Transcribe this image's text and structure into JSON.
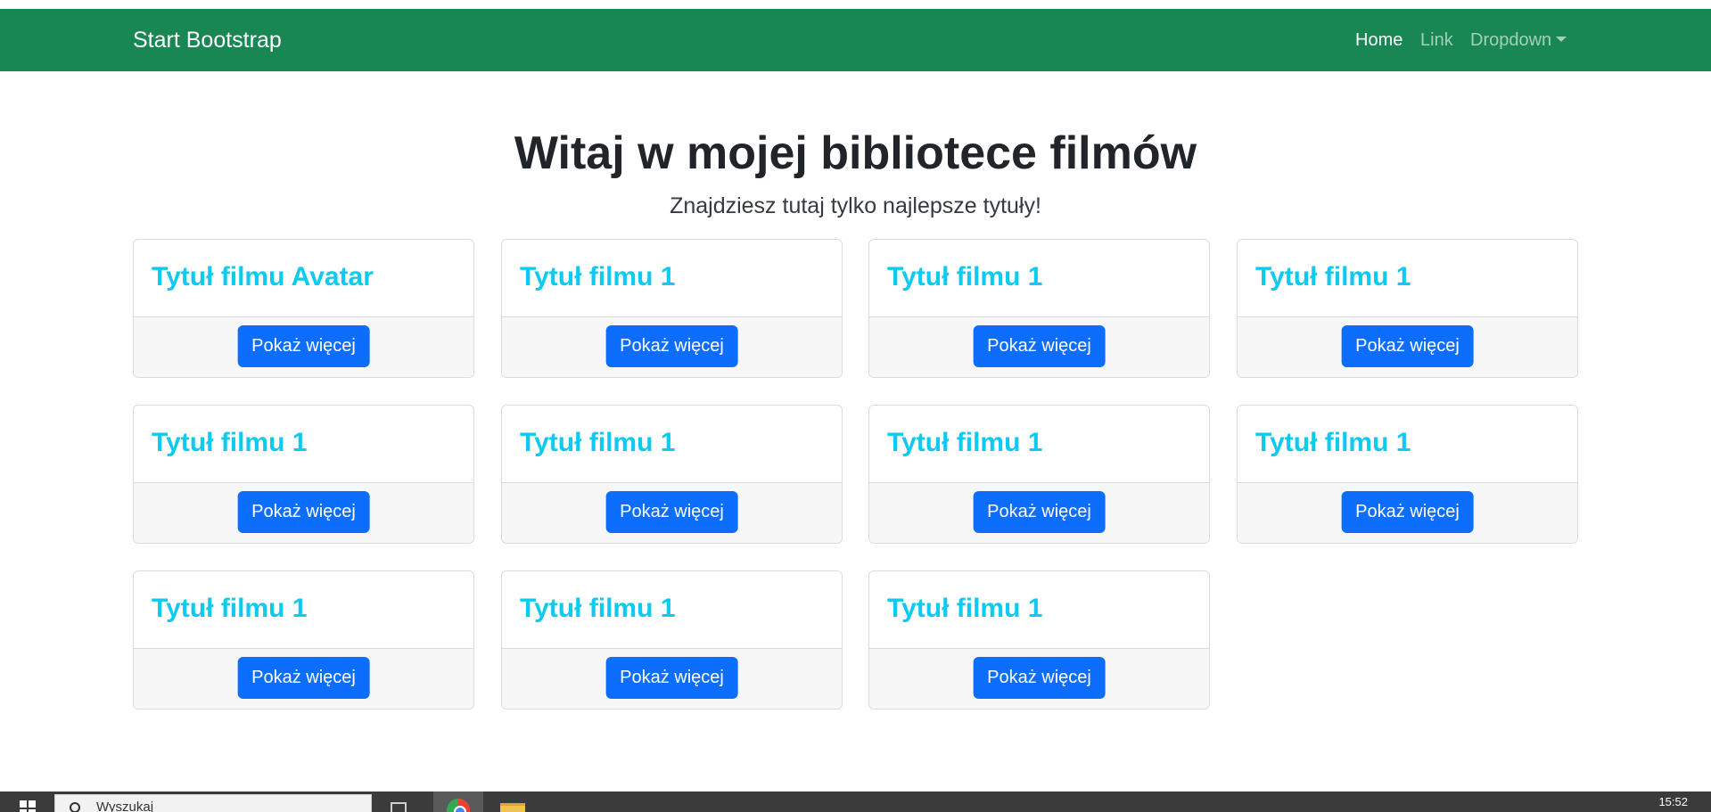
{
  "navbar": {
    "brand": "Start Bootstrap",
    "items": [
      {
        "label": "Home",
        "active": true
      },
      {
        "label": "Link",
        "active": false
      },
      {
        "label": "Dropdown",
        "active": false
      }
    ],
    "background": "#198754"
  },
  "hero": {
    "title": "Witaj w mojej bibliotece filmów",
    "subtitle": "Znajdziesz tutaj tylko najlepsze tytuły!"
  },
  "cards": [
    {
      "title": "Tytuł filmu Avatar",
      "button": "Pokaż więcej"
    },
    {
      "title": "Tytuł filmu 1",
      "button": "Pokaż więcej"
    },
    {
      "title": "Tytuł filmu 1",
      "button": "Pokaż więcej"
    },
    {
      "title": "Tytuł filmu 1",
      "button": "Pokaż więcej"
    },
    {
      "title": "Tytuł filmu 1",
      "button": "Pokaż więcej"
    },
    {
      "title": "Tytuł filmu 1",
      "button": "Pokaż więcej"
    },
    {
      "title": "Tytuł filmu 1",
      "button": "Pokaż więcej"
    },
    {
      "title": "Tytuł filmu 1",
      "button": "Pokaż więcej"
    },
    {
      "title": "Tytuł filmu 1",
      "button": "Pokaż więcej"
    },
    {
      "title": "Tytuł filmu 1",
      "button": "Pokaż więcej"
    },
    {
      "title": "Tytuł filmu 1",
      "button": "Pokaż więcej"
    }
  ],
  "colors": {
    "card_title": "#0dcaf0",
    "button": "#0d6efd",
    "card_footer": "#f7f7f7"
  },
  "taskbar": {
    "search_text": "Wyszukaj",
    "clock": "15:52",
    "icons": [
      "windows-start-icon",
      "search-icon",
      "task-view-icon",
      "chrome-icon",
      "file-explorer-icon"
    ]
  }
}
